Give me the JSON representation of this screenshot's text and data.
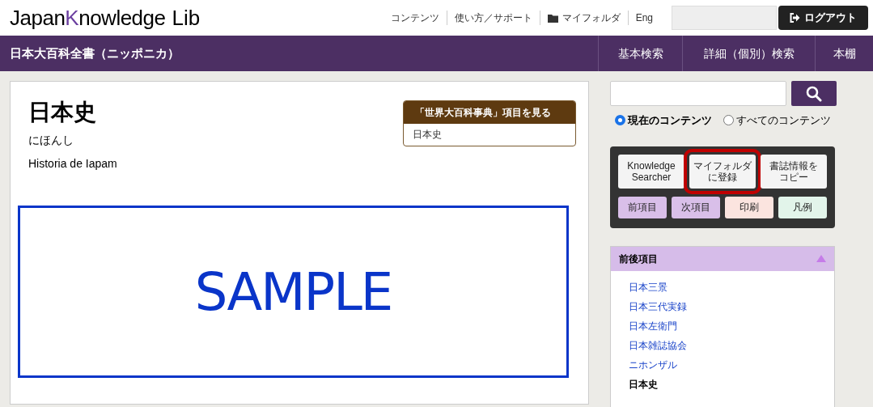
{
  "header": {
    "logo_parts": [
      "Japan",
      "K",
      "nowledge"
    ],
    "logo_suffix": "Lib",
    "links": [
      {
        "label": "コンテンツ",
        "kind": "text"
      },
      {
        "label": "使い方／サポート",
        "kind": "text"
      },
      {
        "label": "マイフォルダ",
        "kind": "folder"
      },
      {
        "label": "Eng",
        "kind": "text"
      }
    ],
    "logout": "ログアウト"
  },
  "nav": {
    "title": "日本大百科全書（ニッポニカ）",
    "items": [
      "基本検索",
      "詳細（個別）検索",
      "本棚"
    ]
  },
  "article": {
    "title": "日本史",
    "reading": "にほんし",
    "foreign": "Historia de Iapam",
    "related": {
      "heading": "「世界大百科事典」項目を見る",
      "link": "日本史"
    },
    "overlay": "SAMPLE"
  },
  "sidebar": {
    "search_scope": [
      {
        "label": "現在のコンテンツ",
        "selected": true
      },
      {
        "label": "すべてのコンテンツ",
        "selected": false
      }
    ],
    "tools": [
      {
        "lines": [
          "Knowledge",
          "Searcher"
        ],
        "highlighted": false
      },
      {
        "lines": [
          "マイフォルダ",
          "に登録"
        ],
        "highlighted": true
      },
      {
        "lines": [
          "書誌情報を",
          "コピー"
        ],
        "highlighted": false
      }
    ],
    "nav_buttons_left": [
      {
        "label": "前項目",
        "color": "#d9bfe9"
      },
      {
        "label": "次項目",
        "color": "#d9bfe9"
      }
    ],
    "nav_buttons_right": [
      {
        "label": "印刷",
        "color": "#fbe4df"
      },
      {
        "label": "凡例",
        "color": "#e2f4ea"
      }
    ],
    "nearby": {
      "heading": "前後項目",
      "expanded": true,
      "items": [
        {
          "label": "日本三景",
          "selected": false
        },
        {
          "label": "日本三代実録",
          "selected": false
        },
        {
          "label": "日本左衛門",
          "selected": false
        },
        {
          "label": "日本雑誌協会",
          "selected": false
        },
        {
          "label": "ニホンザル",
          "selected": false
        },
        {
          "label": "日本史",
          "selected": true
        }
      ]
    }
  }
}
